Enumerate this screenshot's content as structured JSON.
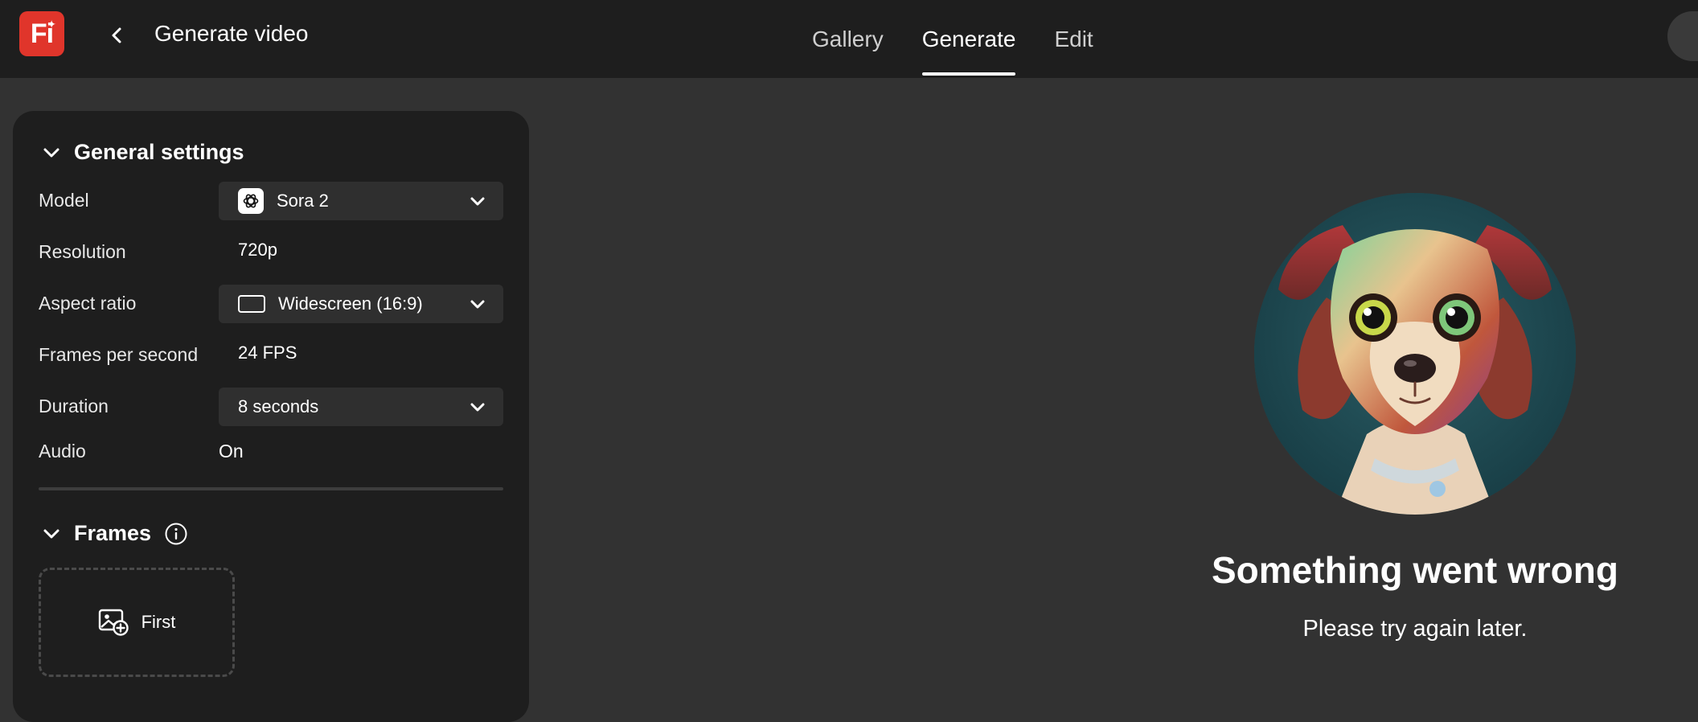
{
  "app": {
    "logo_text": "Fi"
  },
  "header": {
    "title": "Generate video",
    "tabs": [
      {
        "label": "Gallery",
        "active": false
      },
      {
        "label": "Generate",
        "active": true
      },
      {
        "label": "Edit",
        "active": false
      }
    ]
  },
  "settings": {
    "general_title": "General settings",
    "model": {
      "label": "Model",
      "value": "Sora 2"
    },
    "resolution": {
      "label": "Resolution",
      "value": "720p"
    },
    "aspect_ratio": {
      "label": "Aspect ratio",
      "value": "Widescreen (16:9)"
    },
    "fps": {
      "label": "Frames per second",
      "value": "24 FPS"
    },
    "duration": {
      "label": "Duration",
      "value": "8 seconds"
    },
    "audio": {
      "label": "Audio",
      "value": "On"
    },
    "frames_title": "Frames",
    "first_frame_label": "First"
  },
  "error": {
    "title": "Something went wrong",
    "message": "Please try again later."
  },
  "colors": {
    "background": "#323232",
    "topbar": "#1e1e1e",
    "panel": "#1e1e1e",
    "logo": "#e0352b",
    "select": "#2f2f2f"
  }
}
